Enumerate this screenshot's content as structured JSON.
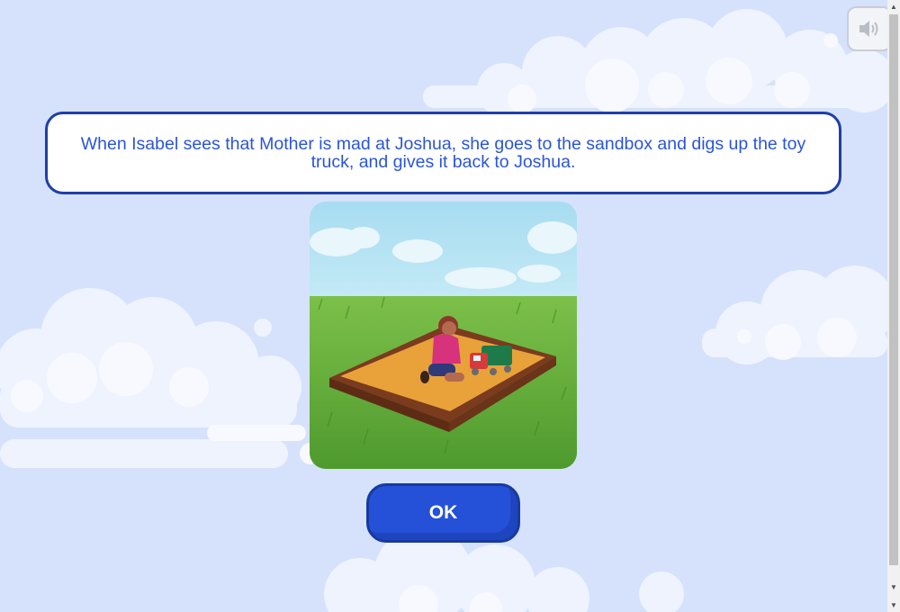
{
  "caption": {
    "text": "When Isabel sees that Mother is mad at Joshua, she goes to the sandbox and digs up the toy truck, and gives it back to Joshua."
  },
  "ok_button": {
    "label": "OK"
  },
  "sound_button": {
    "icon": "speaker-icon"
  },
  "colors": {
    "background": "#d6e2fb",
    "caption_text": "#2a55d6",
    "caption_border": "#1f3fa8",
    "button_fill": "#2551d8",
    "button_border": "#163a9e"
  }
}
